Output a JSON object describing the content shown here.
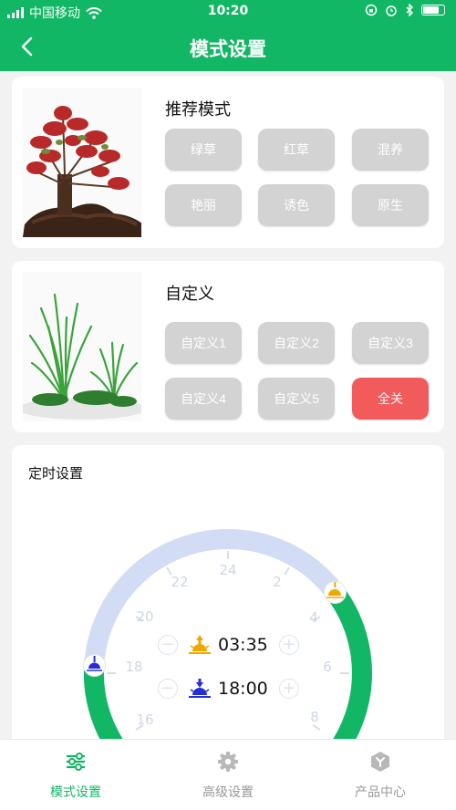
{
  "status_bar": {
    "carrier": "中国移动",
    "time": "10:20"
  },
  "header": {
    "title": "模式设置",
    "back_icon": "chevron-left-icon"
  },
  "recommended": {
    "title": "推荐模式",
    "buttons": [
      "绿草",
      "红草",
      "混养",
      "艳丽",
      "诱色",
      "原生"
    ]
  },
  "custom": {
    "title": "自定义",
    "buttons": [
      "自定义1",
      "自定义2",
      "自定义3",
      "自定义4",
      "自定义5"
    ],
    "all_off": "全关"
  },
  "timer": {
    "title": "定时设置",
    "dial_ticks": [
      "24",
      "2",
      "4",
      "6",
      "8",
      "16",
      "18",
      "20",
      "22"
    ],
    "sunrise": "03:35",
    "sunset": "18:00",
    "colors": {
      "track": "#d3dcf5",
      "active": "#12b765",
      "sunrise_icon": "#f0a800",
      "sunset_icon": "#2430d6"
    }
  },
  "tabs": [
    {
      "label": "模式设置",
      "icon": "sliders-icon",
      "active": true
    },
    {
      "label": "高级设置",
      "icon": "gear-icon",
      "active": false
    },
    {
      "label": "产品中心",
      "icon": "hexagon-icon",
      "active": false
    }
  ],
  "colors": {
    "brand": "#12b765",
    "button_disabled": "#d3d3d3",
    "button_danger": "#f25b5b"
  }
}
